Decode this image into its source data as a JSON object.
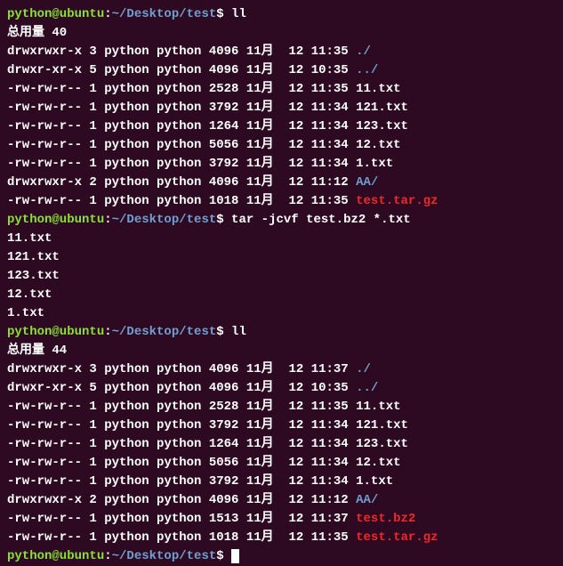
{
  "prompt": {
    "userhost": "python@ubuntu",
    "colon": ":",
    "path": "~/Desktop/test",
    "dollar": "$"
  },
  "block1": {
    "cmd": "ll",
    "total": "总用量 40",
    "rows": [
      {
        "perms": "drwxrwxr-x",
        "links": "3",
        "owner": "python",
        "group": "python",
        "size": "4096",
        "month": "11月",
        "day": "12",
        "time": "11:35",
        "name": "./",
        "type": "dir"
      },
      {
        "perms": "drwxr-xr-x",
        "links": "5",
        "owner": "python",
        "group": "python",
        "size": "4096",
        "month": "11月",
        "day": "12",
        "time": "10:35",
        "name": "../",
        "type": "dir"
      },
      {
        "perms": "-rw-rw-r--",
        "links": "1",
        "owner": "python",
        "group": "python",
        "size": "2528",
        "month": "11月",
        "day": "12",
        "time": "11:35",
        "name": "11.txt",
        "type": "file"
      },
      {
        "perms": "-rw-rw-r--",
        "links": "1",
        "owner": "python",
        "group": "python",
        "size": "3792",
        "month": "11月",
        "day": "12",
        "time": "11:34",
        "name": "121.txt",
        "type": "file"
      },
      {
        "perms": "-rw-rw-r--",
        "links": "1",
        "owner": "python",
        "group": "python",
        "size": "1264",
        "month": "11月",
        "day": "12",
        "time": "11:34",
        "name": "123.txt",
        "type": "file"
      },
      {
        "perms": "-rw-rw-r--",
        "links": "1",
        "owner": "python",
        "group": "python",
        "size": "5056",
        "month": "11月",
        "day": "12",
        "time": "11:34",
        "name": "12.txt",
        "type": "file"
      },
      {
        "perms": "-rw-rw-r--",
        "links": "1",
        "owner": "python",
        "group": "python",
        "size": "3792",
        "month": "11月",
        "day": "12",
        "time": "11:34",
        "name": "1.txt",
        "type": "file"
      },
      {
        "perms": "drwxrwxr-x",
        "links": "2",
        "owner": "python",
        "group": "python",
        "size": "4096",
        "month": "11月",
        "day": "12",
        "time": "11:12",
        "name": "AA/",
        "type": "dir"
      },
      {
        "perms": "-rw-rw-r--",
        "links": "1",
        "owner": "python",
        "group": "python",
        "size": "1018",
        "month": "11月",
        "day": "12",
        "time": "11:35",
        "name": "test.tar.gz",
        "type": "archive"
      }
    ]
  },
  "block2": {
    "cmd": "tar -jcvf test.bz2 *.txt",
    "output": [
      "11.txt",
      "121.txt",
      "123.txt",
      "12.txt",
      "1.txt"
    ]
  },
  "block3": {
    "cmd": "ll",
    "total": "总用量 44",
    "rows": [
      {
        "perms": "drwxrwxr-x",
        "links": "3",
        "owner": "python",
        "group": "python",
        "size": "4096",
        "month": "11月",
        "day": "12",
        "time": "11:37",
        "name": "./",
        "type": "dir"
      },
      {
        "perms": "drwxr-xr-x",
        "links": "5",
        "owner": "python",
        "group": "python",
        "size": "4096",
        "month": "11月",
        "day": "12",
        "time": "10:35",
        "name": "../",
        "type": "dir"
      },
      {
        "perms": "-rw-rw-r--",
        "links": "1",
        "owner": "python",
        "group": "python",
        "size": "2528",
        "month": "11月",
        "day": "12",
        "time": "11:35",
        "name": "11.txt",
        "type": "file"
      },
      {
        "perms": "-rw-rw-r--",
        "links": "1",
        "owner": "python",
        "group": "python",
        "size": "3792",
        "month": "11月",
        "day": "12",
        "time": "11:34",
        "name": "121.txt",
        "type": "file"
      },
      {
        "perms": "-rw-rw-r--",
        "links": "1",
        "owner": "python",
        "group": "python",
        "size": "1264",
        "month": "11月",
        "day": "12",
        "time": "11:34",
        "name": "123.txt",
        "type": "file"
      },
      {
        "perms": "-rw-rw-r--",
        "links": "1",
        "owner": "python",
        "group": "python",
        "size": "5056",
        "month": "11月",
        "day": "12",
        "time": "11:34",
        "name": "12.txt",
        "type": "file"
      },
      {
        "perms": "-rw-rw-r--",
        "links": "1",
        "owner": "python",
        "group": "python",
        "size": "3792",
        "month": "11月",
        "day": "12",
        "time": "11:34",
        "name": "1.txt",
        "type": "file"
      },
      {
        "perms": "drwxrwxr-x",
        "links": "2",
        "owner": "python",
        "group": "python",
        "size": "4096",
        "month": "11月",
        "day": "12",
        "time": "11:12",
        "name": "AA/",
        "type": "dir"
      },
      {
        "perms": "-rw-rw-r--",
        "links": "1",
        "owner": "python",
        "group": "python",
        "size": "1513",
        "month": "11月",
        "day": "12",
        "time": "11:37",
        "name": "test.bz2",
        "type": "archive"
      },
      {
        "perms": "-rw-rw-r--",
        "links": "1",
        "owner": "python",
        "group": "python",
        "size": "1018",
        "month": "11月",
        "day": "12",
        "time": "11:35",
        "name": "test.tar.gz",
        "type": "archive"
      }
    ]
  }
}
